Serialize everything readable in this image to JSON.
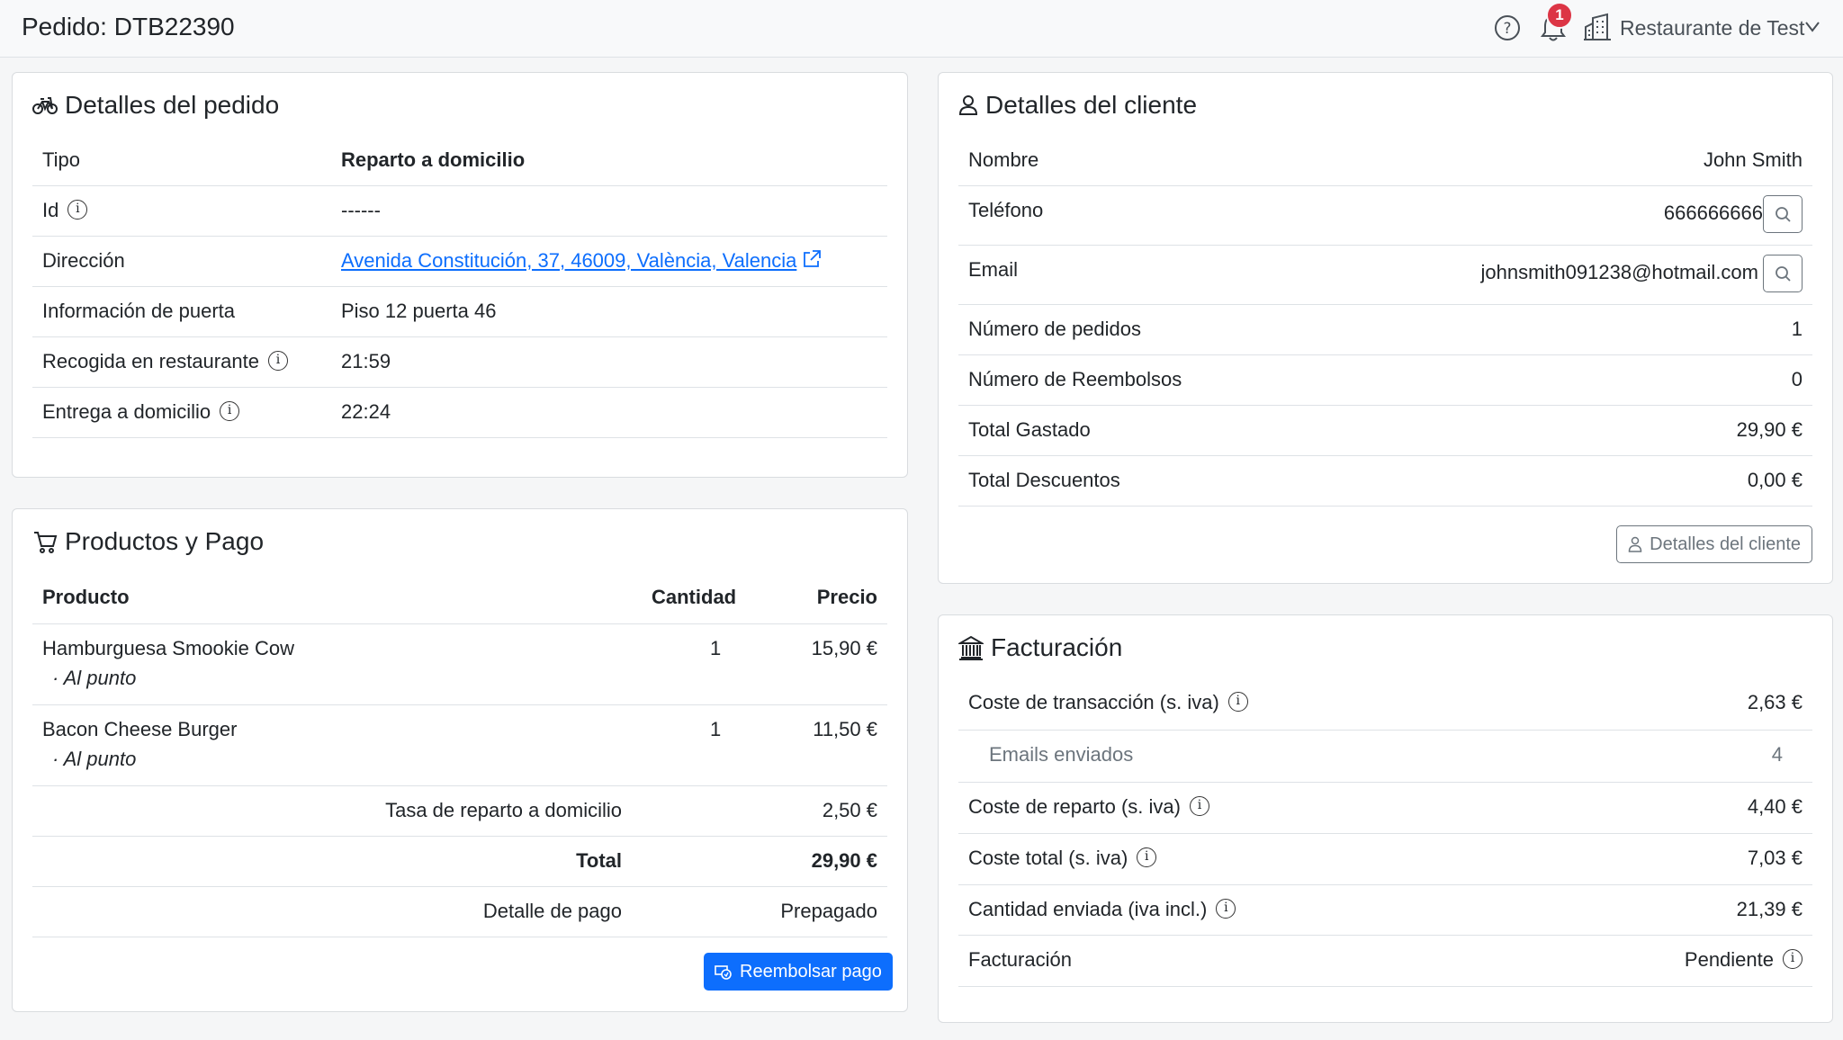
{
  "header": {
    "title": "Pedido: DTB22390",
    "notifications_count": "1",
    "restaurant": "Restaurante de Test"
  },
  "order_details": {
    "title": "Detalles del pedido",
    "rows": [
      {
        "label": "Tipo",
        "value": "Reparto a domicilio"
      },
      {
        "label": "Id",
        "value": "------"
      },
      {
        "label": "Dirección",
        "value": "Avenida Constitución, 37, 46009, València, Valencia"
      },
      {
        "label": "Información de puerta",
        "value": "Piso 12 puerta 46"
      },
      {
        "label": "Recogida en restaurante",
        "value": "21:59"
      },
      {
        "label": "Entrega a domicilio",
        "value": "22:24"
      }
    ]
  },
  "products": {
    "title": "Productos y Pago",
    "columns": {
      "product": "Producto",
      "quantity": "Cantidad",
      "price": "Precio"
    },
    "items": [
      {
        "name": "Hamburguesa Smookie Cow",
        "option": "· Al punto",
        "quantity": "1",
        "price": "15,90 €"
      },
      {
        "name": "Bacon Cheese Burger",
        "option": "· Al punto",
        "quantity": "1",
        "price": "11,50 €"
      }
    ],
    "delivery_fee_label": "Tasa de reparto a domicilio",
    "delivery_fee": "2,50 €",
    "total_label": "Total",
    "total": "29,90 €",
    "payment_label": "Detalle de pago",
    "payment": "Prepagado",
    "refund_button": "Reembolsar pago"
  },
  "customer": {
    "title": "Detalles del cliente",
    "name_label": "Nombre",
    "name": "John Smith",
    "phone_label": "Teléfono",
    "phone": "666666666",
    "email_label": "Email",
    "email": "johnsmith091238@hotmail.com",
    "orders_label": "Número de pedidos",
    "orders": "1",
    "refunds_label": "Número de Reembolsos",
    "refunds": "0",
    "spent_label": "Total Gastado",
    "spent": "29,90 €",
    "discounts_label": "Total Descuentos",
    "discounts": "0,00 €",
    "details_button": "Detalles del cliente"
  },
  "billing": {
    "title": "Facturación",
    "transaction_label": "Coste de transacción (s. iva)",
    "transaction": "2,63 €",
    "emails_label": "Emails enviados",
    "emails": "4",
    "delivery_label": "Coste de reparto (s. iva)",
    "delivery": "4,40 €",
    "total_cost_label": "Coste total (s. iva)",
    "total_cost": "7,03 €",
    "sent_label": "Cantidad enviada (iva incl.)",
    "sent": "21,39 €",
    "billing_label": "Facturación",
    "billing_status": "Pendiente"
  },
  "colors": {
    "primary": "#0d6efd",
    "badge": "#dc3545"
  }
}
